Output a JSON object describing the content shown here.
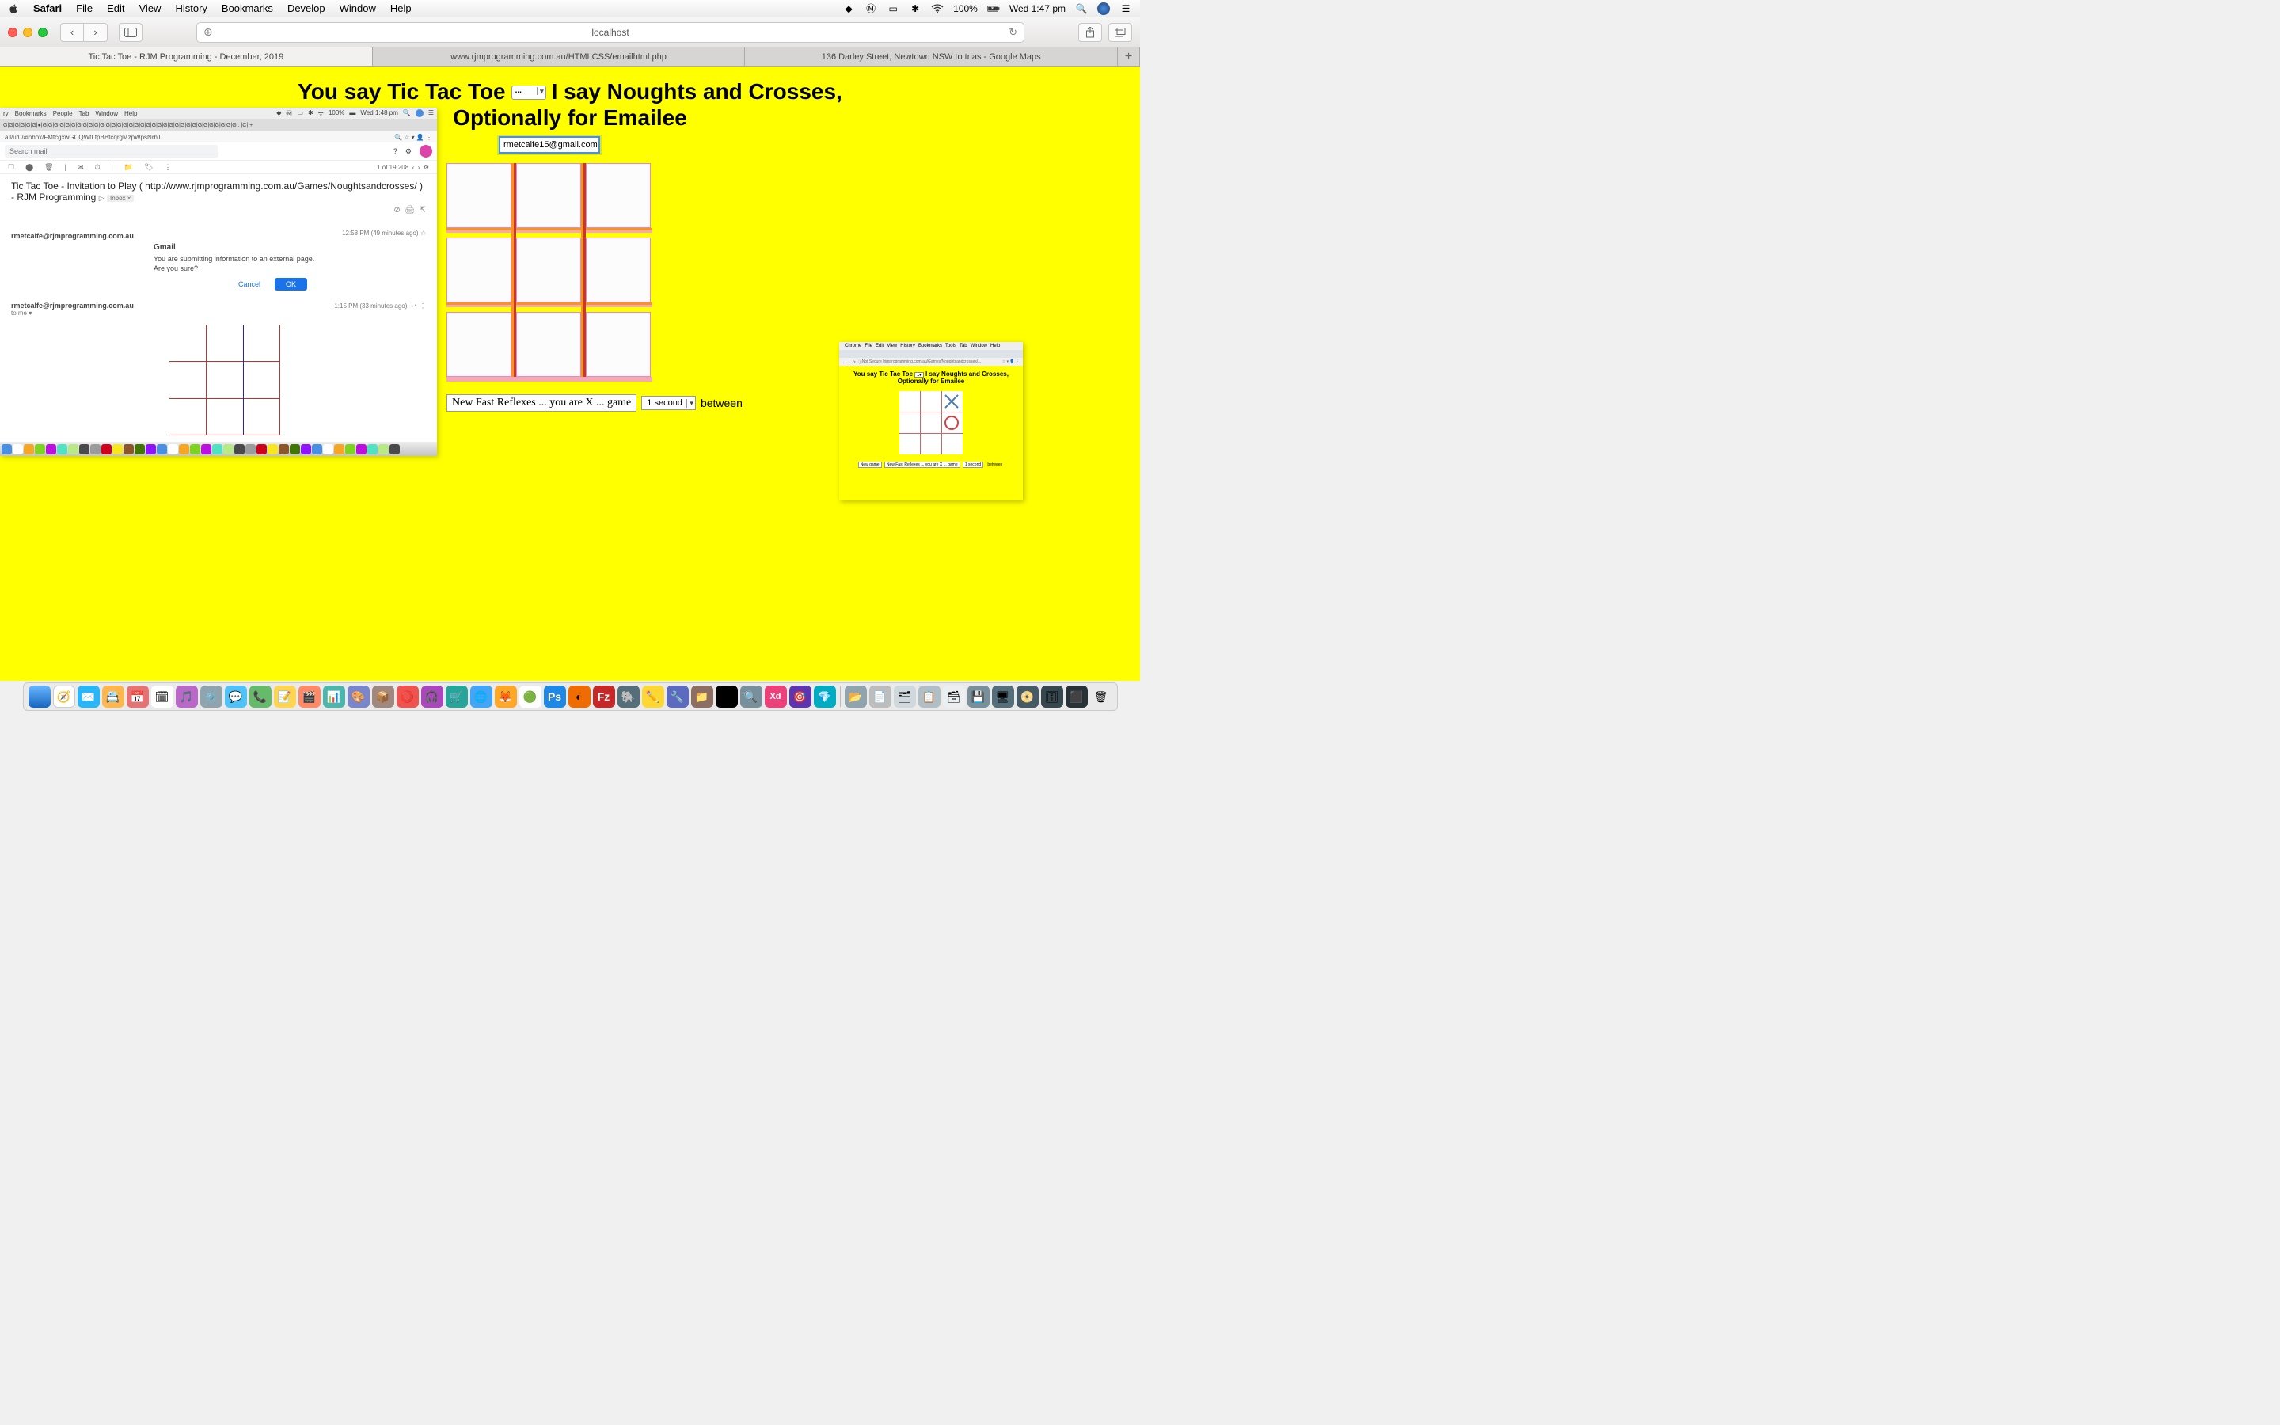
{
  "menubar": {
    "app": "Safari",
    "items": [
      "File",
      "Edit",
      "View",
      "History",
      "Bookmarks",
      "Develop",
      "Window",
      "Help"
    ],
    "battery": "100%",
    "clock": "Wed 1:47 pm"
  },
  "safari": {
    "url": "localhost",
    "tabs": [
      "Tic Tac Toe - RJM Programming - December, 2019",
      "www.rjmprogramming.com.au/HTMLCSS/emailhtml.php",
      "136 Darley Street, Newtown NSW to trias - Google Maps"
    ]
  },
  "page": {
    "title_a": "You say Tic Tac Toe",
    "title_b": "I say Noughts and Crosses,",
    "title_c": "Optionally for Emailee",
    "email": "rmetcalfe15@gmail.com",
    "controls": {
      "button": "New Fast Reflexes ... you are X ... game",
      "select": "1 second",
      "after": "between"
    }
  },
  "gmail": {
    "menubar_items": [
      "ry",
      "Bookmarks",
      "People",
      "Tab",
      "Window",
      "Help"
    ],
    "menubar_battery": "100%",
    "menubar_clock": "Wed 1:48 pm",
    "url": "ail/u/0/#inbox/FMfcgxwGCQWtLtpBBfcqrgMzpWpsNrhT",
    "search_placeholder": "Search mail",
    "count": "1 of 19,208",
    "subject": "Tic Tac Toe - Invitation to Play ( http://www.rjmprogramming.com.au/Games/Noughtsandcrosses/ ) - RJM Programming",
    "inbox_chip": "Inbox ×",
    "sender1": "rmetcalfe@rjmprogramming.com.au",
    "sender1_label": "Gmail",
    "sender1_time": "12:58 PM (49 minutes ago)",
    "dialog_line1": "You are submitting information to an external page.",
    "dialog_line2": "Are you sure?",
    "cancel": "Cancel",
    "ok": "OK",
    "sender2": "rmetcalfe@rjmprogramming.com.au",
    "sender2_sub": "to me",
    "sender2_time": "1:15 PM (33 minutes ago)"
  },
  "chrome": {
    "menubar_items": [
      "Chrome",
      "File",
      "Edit",
      "View",
      "History",
      "Bookmarks",
      "Tools",
      "Tab",
      "Window",
      "Help"
    ],
    "url_prefix": "Not Secure |",
    "url": "rjmprogramming.com.au/Games/Noughtsandcrosses/...",
    "title_a": "You say Tic Tac Toe",
    "title_b": "I say Noughts and Crosses,",
    "title_c": "Optionally for Emailee",
    "controls": {
      "btn1": "New game",
      "btn2": "New Fast Reflexes ... you are X ... game",
      "sel": "1 second",
      "after": "between"
    }
  }
}
